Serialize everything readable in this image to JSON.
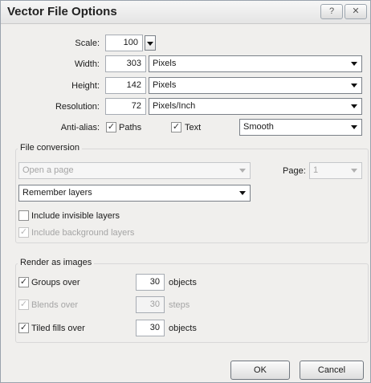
{
  "title": "Vector File Options",
  "title_buttons": {
    "help_label": "?",
    "close_label": "✕"
  },
  "scale": {
    "label": "Scale:",
    "value": "100"
  },
  "width": {
    "label": "Width:",
    "value": "303",
    "unit": "Pixels"
  },
  "height": {
    "label": "Height:",
    "value": "142",
    "unit": "Pixels"
  },
  "resolution": {
    "label": "Resolution:",
    "value": "72",
    "unit": "Pixels/Inch"
  },
  "anti_alias": {
    "label": "Anti-alias:",
    "paths_label": "Paths",
    "text_label": "Text",
    "mode": "Smooth"
  },
  "file_conversion": {
    "title": "File conversion",
    "open_page": "Open a page",
    "page_label": "Page:",
    "page_value": "1",
    "layers_option": "Remember layers",
    "include_invisible": "Include invisible layers",
    "include_background": "Include background layers"
  },
  "render_as_images": {
    "title": "Render as images",
    "groups_label": "Groups over",
    "groups_value": "30",
    "groups_unit": "objects",
    "blends_label": "Blends over",
    "blends_value": "30",
    "blends_unit": "steps",
    "tiled_label": "Tiled fills over",
    "tiled_value": "30",
    "tiled_unit": "objects"
  },
  "buttons": {
    "ok": "OK",
    "cancel": "Cancel"
  },
  "checkmark": "✓"
}
